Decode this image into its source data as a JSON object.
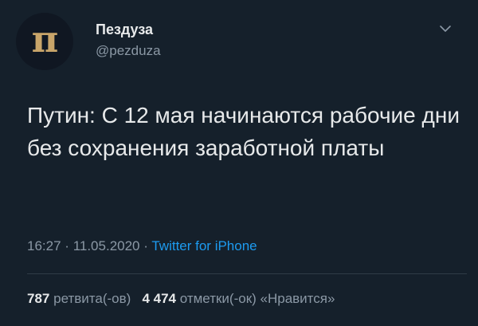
{
  "author": {
    "avatar_glyph": "п",
    "name": "Пездуза",
    "handle": "@pezduza"
  },
  "icons": {
    "menu": "chevron-down-icon"
  },
  "tweet": {
    "text": "Путин: С 12 мая начинаются рабочие дни без сохранения заработной платы",
    "time": "16:27",
    "sep1": "·",
    "date": "11.05.2020",
    "sep2": "·",
    "source": "Twitter for iPhone"
  },
  "stats": {
    "retweets_count": "787",
    "retweets_label": "ретвита(-ов)",
    "likes_count": "4 474",
    "likes_label": "отметки(-ок) «Нравится»"
  },
  "colors": {
    "background": "#15202b",
    "text": "#e7e9ea",
    "secondary": "#8b98a5",
    "accent": "#1d9bf0",
    "avatar_glyph": "#c9a56a"
  }
}
